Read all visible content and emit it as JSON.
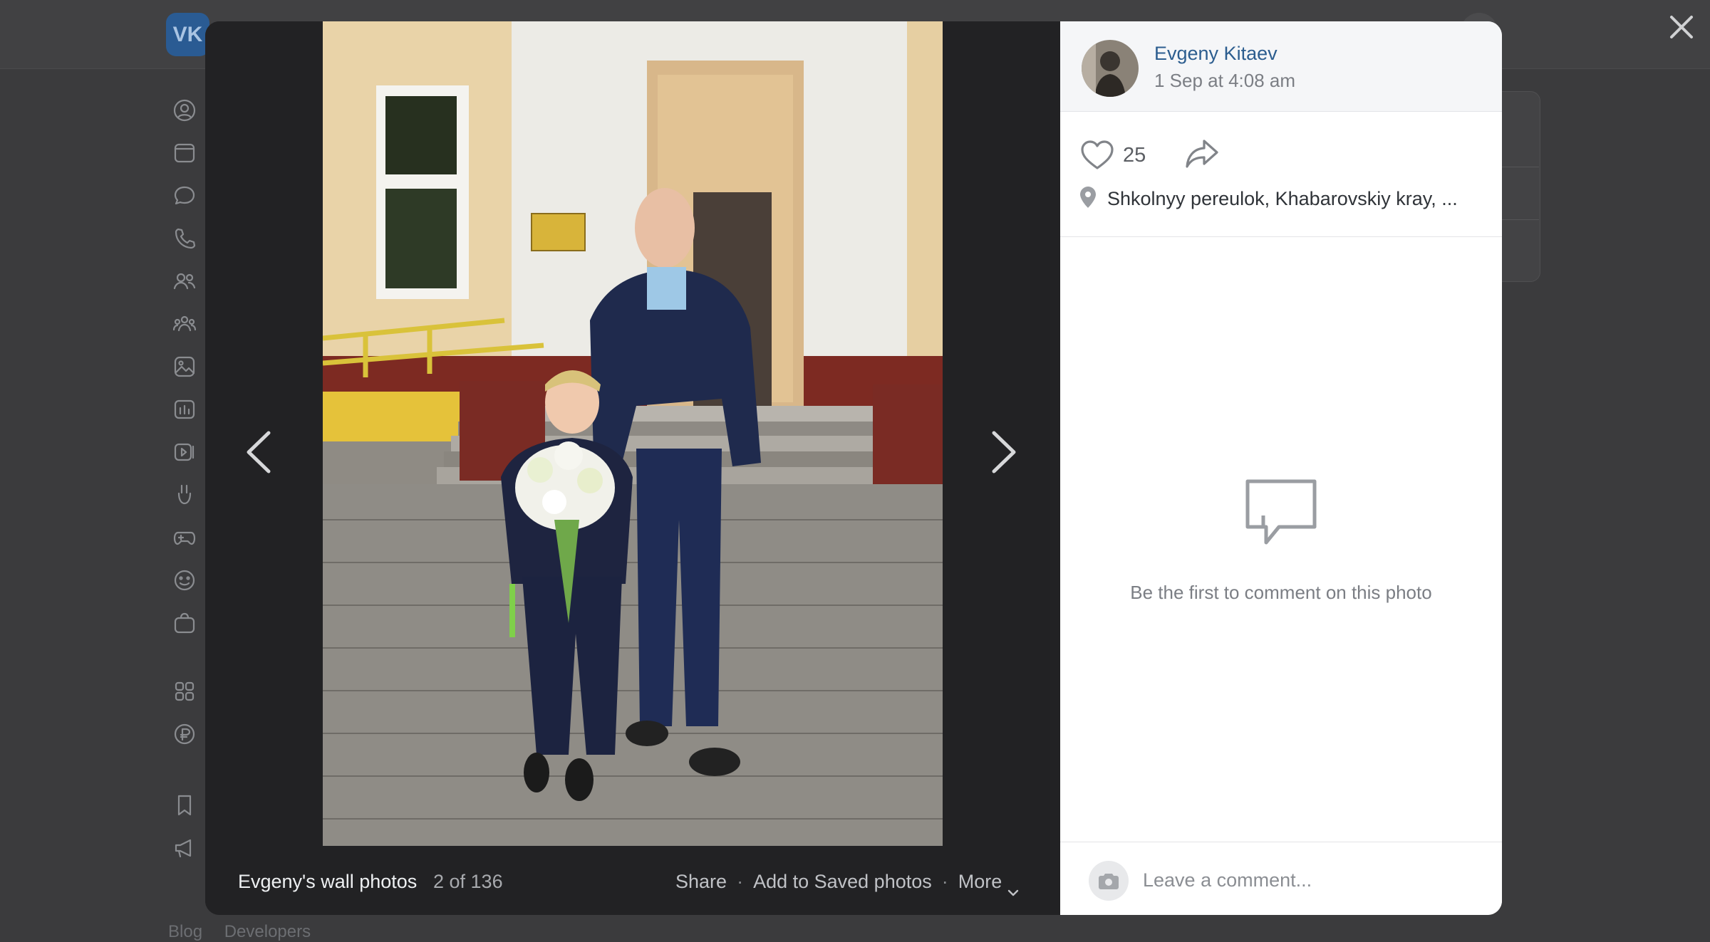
{
  "background": {
    "logo_text": "VK",
    "footer_links": [
      "Blog",
      "Developers"
    ],
    "sidebar_icons": [
      "profile-icon",
      "news-icon",
      "messages-icon",
      "calls-icon",
      "friends-icon",
      "communities-icon",
      "photos-icon",
      "music-icon",
      "video-icon",
      "clips-icon",
      "games-icon",
      "stickers-icon",
      "market-icon",
      "apps-icon",
      "vk-pay-icon",
      "bookmarks-icon",
      "ads-icon"
    ]
  },
  "viewer": {
    "album_title": "Evgeny's wall photos",
    "counter": "2 of 136",
    "actions": {
      "share": "Share",
      "save": "Add to Saved photos",
      "more": "More"
    },
    "separator": "·"
  },
  "post": {
    "author_name": "Evgeny Kitaev",
    "date": "1 Sep at 4:08 am",
    "likes": "25",
    "location": "Shkolnyy pereulok, Khabarovskiy kray, ...",
    "empty_comments_text": "Be the first to comment on this photo",
    "comment_placeholder": "Leave a comment..."
  },
  "colors": {
    "link_blue": "#2c5d8f",
    "viewer_bg": "#222224",
    "overlay": "#3b3b3d"
  }
}
